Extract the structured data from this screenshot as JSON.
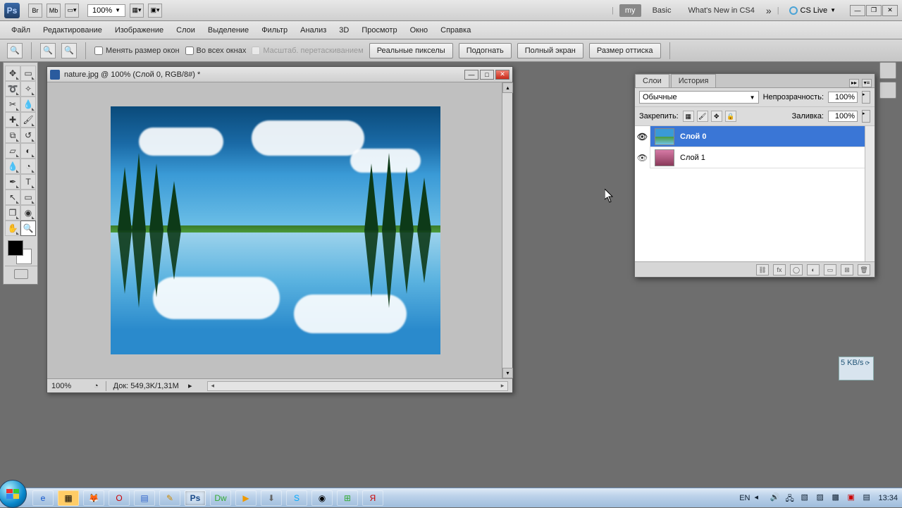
{
  "topbar": {
    "zoom": "100%",
    "workspaces": {
      "my": "my",
      "basic": "Basic",
      "whatsnew": "What's New in CS4"
    },
    "cslive": "CS Live"
  },
  "menu": {
    "file": "Файл",
    "edit": "Редактирование",
    "image": "Изображение",
    "layer": "Слои",
    "select": "Выделение",
    "filter": "Фильтр",
    "analysis": "Анализ",
    "three_d": "3D",
    "view": "Просмотр",
    "window": "Окно",
    "help": "Справка"
  },
  "options": {
    "resize_windows": "Менять размер окон",
    "all_windows": "Во всех окнах",
    "scrubby": "Масштаб. перетаскиванием",
    "actual_pixels": "Реальные пикселы",
    "fit_screen": "Подогнать",
    "fill_screen": "Полный экран",
    "print_size": "Размер оттиска"
  },
  "doc": {
    "title": "nature.jpg @ 100% (Слой 0, RGB/8#) *",
    "zoom": "100%",
    "docinfo": "Док: 549,3K/1,31M"
  },
  "layers_panel": {
    "tab_layers": "Слои",
    "tab_history": "История",
    "blend_mode": "Обычные",
    "opacity_label": "Непрозрачность:",
    "opacity_value": "100%",
    "lock_label": "Закрепить:",
    "fill_label": "Заливка:",
    "fill_value": "100%",
    "layers": [
      {
        "name": "Слой 0",
        "selected": true
      },
      {
        "name": "Слой 1",
        "selected": false
      }
    ]
  },
  "float_widget": {
    "text": "5 KB/s"
  },
  "taskbar": {
    "lang": "EN",
    "time": "13:34"
  }
}
